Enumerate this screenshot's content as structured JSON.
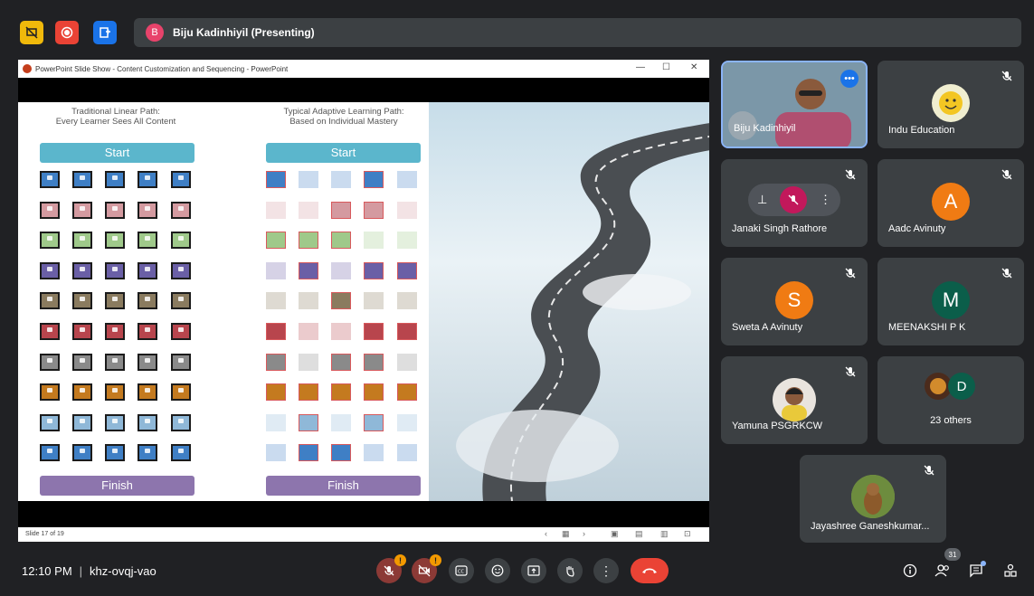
{
  "presenter": {
    "initial": "B",
    "label": "Biju Kadinhiyil (Presenting)"
  },
  "ppt": {
    "window_title": "PowerPoint Slide Show  -  Content Customization and Sequencing  -  PowerPoint",
    "slide_counter": "Slide 17 of 19",
    "left_heading": [
      "Traditional Linear Path:",
      "Every Learner Sees All Content"
    ],
    "right_heading": [
      "Typical Adaptive Learning Path:",
      "Based on Individual Mastery"
    ],
    "start_label": "Start",
    "finish_label": "Finish",
    "row_colors": [
      "#3f7fc5",
      "#d49aa0",
      "#9fc98a",
      "#6a5fa6",
      "#8a7b5f",
      "#b8454d",
      "#8a8a8a",
      "#c47a1f",
      "#8fb8d8",
      "#3f7fc5"
    ]
  },
  "participants": [
    {
      "name": "Biju Kadinhiyil",
      "type": "video"
    },
    {
      "name": "Indu Education",
      "type": "photo"
    },
    {
      "name": "Janaki Singh Rathore",
      "type": "hover"
    },
    {
      "name": "Aadc Avinuty",
      "initial": "A",
      "color": "#f07b13"
    },
    {
      "name": "Sweta A Avinuty",
      "initial": "S",
      "color": "#f07b13"
    },
    {
      "name": "MEENAKSHI P K",
      "initial": "M",
      "color": "#0b5e4a"
    },
    {
      "name": "Yamuna PSGRKCW",
      "type": "photo"
    },
    {
      "name": "23 others",
      "initial": "D",
      "color": "#0b5e4a"
    },
    {
      "name": "Jayashree Ganeshkumar...",
      "type": "photo"
    }
  ],
  "meeting": {
    "time": "12:10 PM",
    "code": "khz-ovqj-vao",
    "participant_count": "31"
  },
  "colors": {
    "bg": "#202124",
    "tile": "#3c4043",
    "leave": "#ea4335",
    "warning": "#f29900"
  }
}
